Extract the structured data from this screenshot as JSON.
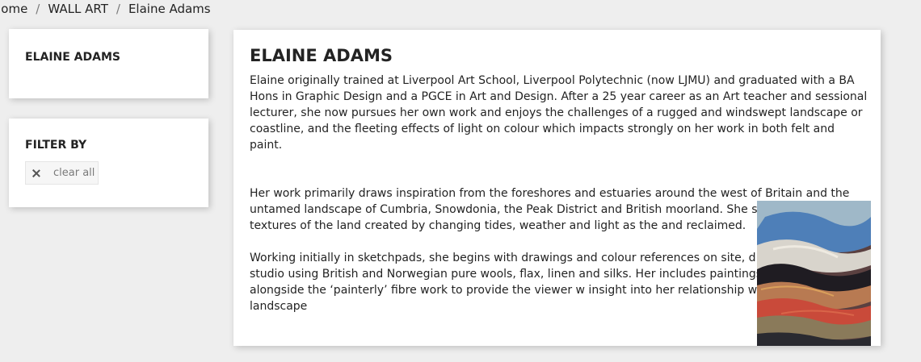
{
  "breadcrumb": {
    "items": [
      "Home",
      "WALL ART",
      "Elaine Adams"
    ],
    "separator": "/"
  },
  "sidebar": {
    "category_title": "ELAINE ADAMS",
    "filter_title": "FILTER BY",
    "clear_all_label": "clear all"
  },
  "main": {
    "title": "ELAINE ADAMS",
    "paragraphs": [
      "Elaine originally trained at Liverpool Art School, Liverpool Polytechnic (now LJMU) and graduated with a BA Hons in Graphic Design and a PGCE in Art and Design. After a 25 year career as an Art teacher and sessional lecturer, she now pursues her own work and enjoys the challenges of a rugged and windswept landscape or coastline, and the fleeting effects of light on colour which impacts strongly on her work in both felt and paint.",
      "Her work primarily draws inspiration from the foreshores and estuaries around the west of Britain and the untamed landscape of Cumbria, Snowdonia, the Peak District and British moorland. She s the patterns and textures of the land created by changing tides, weather and light as the and reclaimed.",
      "Working initially in sketchpads, she begins with drawings and colour references on site, d work back in the studio using British and Norwegian pure wools, flax, linen and silks.  Her includes paintings which stand alongside the ‘painterly’ fibre work to provide the viewer w insight into her relationship with the great British landscape"
    ]
  },
  "icons": {
    "clear": "close-icon"
  },
  "colors": {
    "background": "#eeeeee",
    "panel": "#ffffff",
    "text": "#232323",
    "muted": "#7a7a7a"
  }
}
